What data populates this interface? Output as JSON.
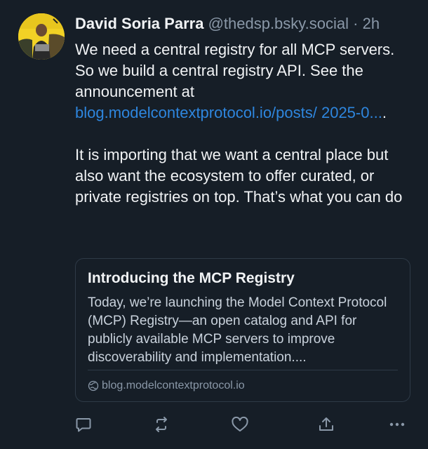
{
  "post": {
    "author_name": "David Soria Parra",
    "author_handle": "@thedsp.bsky.social",
    "separator": "·",
    "time": "2h",
    "text_part1": "We need a central registry for all MCP servers. So we build a central registry API. See the announcement at ",
    "link_text": "blog.modelcontextprotocol.io/posts/ 2025-0...",
    "text_part1_end": ".",
    "text_part2": "It is importing that we want a central place but also want the ecosystem to offer curated, or private registries on top. That’s what you can do"
  },
  "card": {
    "title": "Introducing the MCP Registry",
    "description": "Today, we’re launching the Model Context Protocol (MCP) Registry—an open catalog and API for publicly available MCP servers to improve discoverability and implementation....",
    "domain": "blog.modelcontextprotocol.io"
  },
  "actions": [
    {
      "icon": "reply-icon"
    },
    {
      "icon": "repost-icon"
    },
    {
      "icon": "like-icon"
    },
    {
      "icon": "share-icon"
    },
    {
      "icon": "more-icon"
    }
  ],
  "colors": {
    "background": "#161e27",
    "link": "#2e86de",
    "muted": "#8a98a8",
    "avatar_bg": "#f2d225"
  }
}
